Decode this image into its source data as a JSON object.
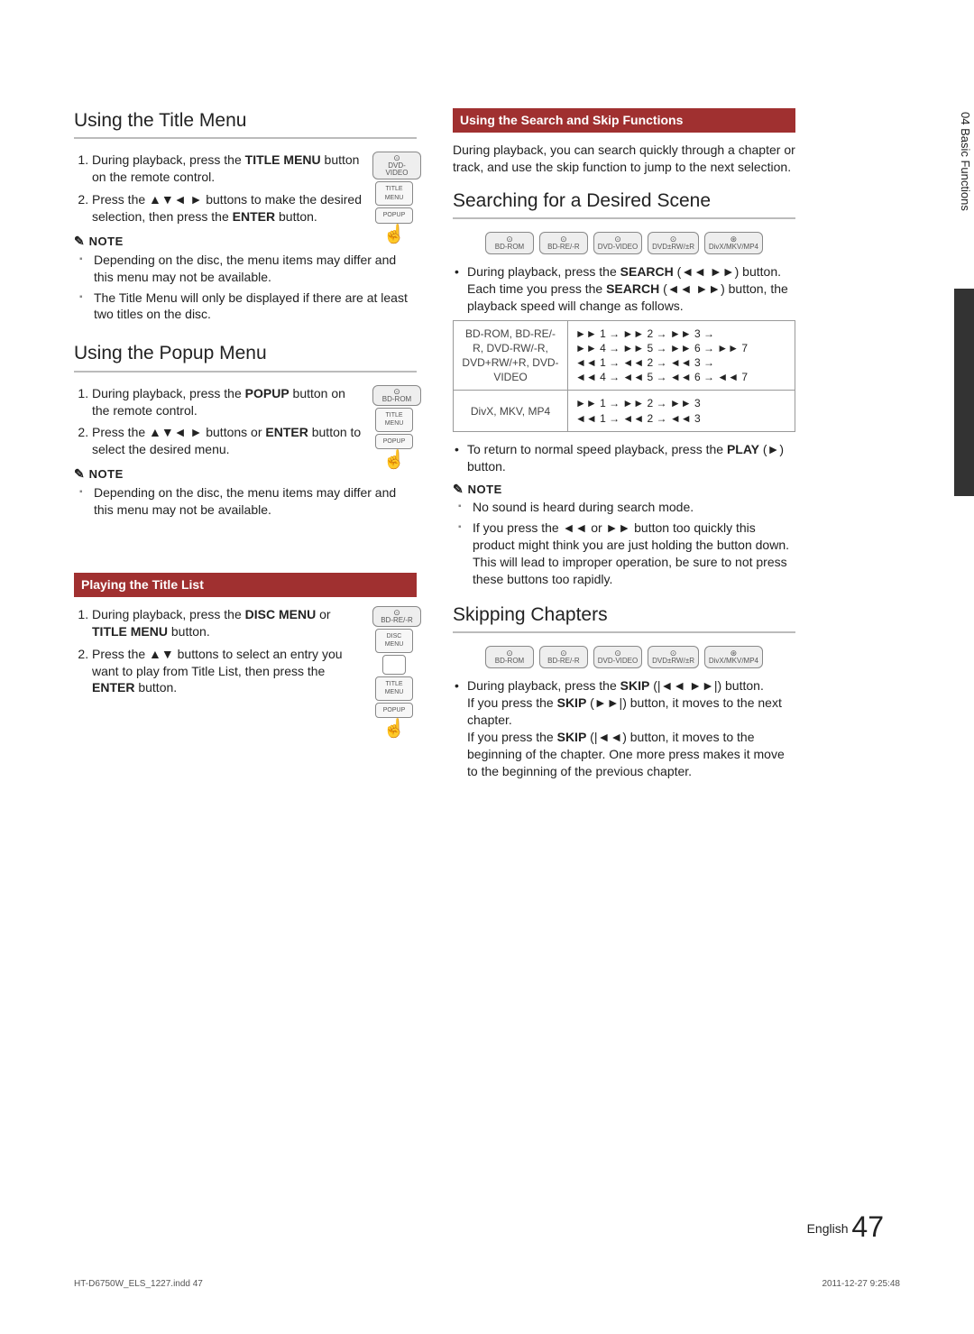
{
  "side_tab": "04  Basic Functions",
  "left": {
    "s1": {
      "title": "Using the Title Menu",
      "badge": "DVD-VIDEO",
      "remote_labels": [
        "TITLE MENU",
        "POPUP"
      ],
      "steps": [
        {
          "pre": "During playback, press the ",
          "b": "TITLE MENU",
          "post": " button on the remote control."
        },
        {
          "pre": "Press the ▲▼◄ ► buttons to make the desired selection, then press the ",
          "b": "ENTER",
          "post": " button."
        }
      ],
      "note_label": "NOTE",
      "notes": [
        "Depending on the disc, the menu items may differ and this menu may not be available.",
        "The Title Menu will only be displayed if there are at least two titles on the disc."
      ]
    },
    "s2": {
      "title": "Using the Popup Menu",
      "badge": "BD-ROM",
      "remote_labels": [
        "TITLE MENU",
        "POPUP"
      ],
      "steps": [
        {
          "pre": "During playback, press the ",
          "b": "POPUP",
          "post": " button on the remote control."
        },
        {
          "pre": "Press the ▲▼◄ ► buttons or ",
          "b": "ENTER",
          "post": " button to select the desired menu."
        }
      ],
      "note_label": "NOTE",
      "notes": [
        "Depending on the disc, the menu items may differ and this menu may not be available."
      ]
    },
    "sub": {
      "title": "Playing the Title List",
      "badge": "BD-RE/-R",
      "remote_labels": [
        "DISC MENU",
        "TITLE MENU",
        "POPUP"
      ],
      "steps": [
        {
          "pre": "During playback, press the ",
          "b": "DISC MENU",
          "mid": " or ",
          "b2": "TITLE MENU",
          "post": " button."
        },
        {
          "pre": "Press the ▲▼ buttons to select an entry you want to play from Title List, then press the ",
          "b": "ENTER",
          "post": " button."
        }
      ]
    }
  },
  "right": {
    "sub": {
      "title": "Using the Search and Skip Functions",
      "intro": "During playback, you can search quickly through a chapter or track, and use the skip function to jump to the next selection."
    },
    "s1": {
      "title": "Searching for a Desired Scene",
      "badges": [
        "BD-ROM",
        "BD-RE/-R",
        "DVD-VIDEO",
        "DVD±RW/±R",
        "DivX/MKV/MP4"
      ],
      "bullet1_pre": "During playback, press the ",
      "bullet1_b": "SEARCH",
      "bullet1_post": " (◄◄ ►►) button.",
      "bullet1_line2_pre": "Each time you press the ",
      "bullet1_line2_b": "SEARCH",
      "bullet1_line2_post": " (◄◄ ►►) button, the playback speed will change as follows.",
      "table": [
        {
          "formats": "BD-ROM, BD-RE/-R, DVD-RW/-R, DVD+RW/+R, DVD-VIDEO",
          "speeds": "►► 1 → ►► 2 → ►► 3 →\n►► 4 → ►► 5 → ►► 6 → ►► 7\n◄◄ 1 → ◄◄ 2 → ◄◄ 3 →\n◄◄ 4 → ◄◄ 5 → ◄◄ 6 → ◄◄ 7"
        },
        {
          "formats": "DivX, MKV, MP4",
          "speeds": "►► 1 → ►► 2 → ►► 3\n◄◄ 1 → ◄◄ 2 → ◄◄ 3"
        }
      ],
      "bullet2_pre": "To return to normal speed playback, press the ",
      "bullet2_b": "PLAY",
      "bullet2_post": " (►) button.",
      "note_label": "NOTE",
      "notes": [
        "No sound is heard during search mode.",
        "If you press the ◄◄ or ►► button too quickly this product might think you are just holding the button down. This will lead to improper operation, be sure to not press these buttons too rapidly."
      ]
    },
    "s2": {
      "title": "Skipping Chapters",
      "badges": [
        "BD-ROM",
        "BD-RE/-R",
        "DVD-VIDEO",
        "DVD±RW/±R",
        "DivX/MKV/MP4"
      ],
      "bullet_pre": "During playback, press the ",
      "bullet_b": "SKIP",
      "bullet_post": " (|◄◄ ►►|) button.",
      "line2_pre": "If you press the ",
      "line2_b": "SKIP",
      "line2_post": " (►►|) button, it moves to the next chapter.",
      "line3_pre": "If you press the ",
      "line3_b": "SKIP",
      "line3_post": " (|◄◄) button, it moves to the beginning of the chapter. One more press makes it move to the beginning of the previous chapter."
    }
  },
  "footer": {
    "lang": "English",
    "page": "47",
    "file": "HT-D6750W_ELS_1227.indd   47",
    "datetime": "2011-12-27     9:25:48"
  }
}
